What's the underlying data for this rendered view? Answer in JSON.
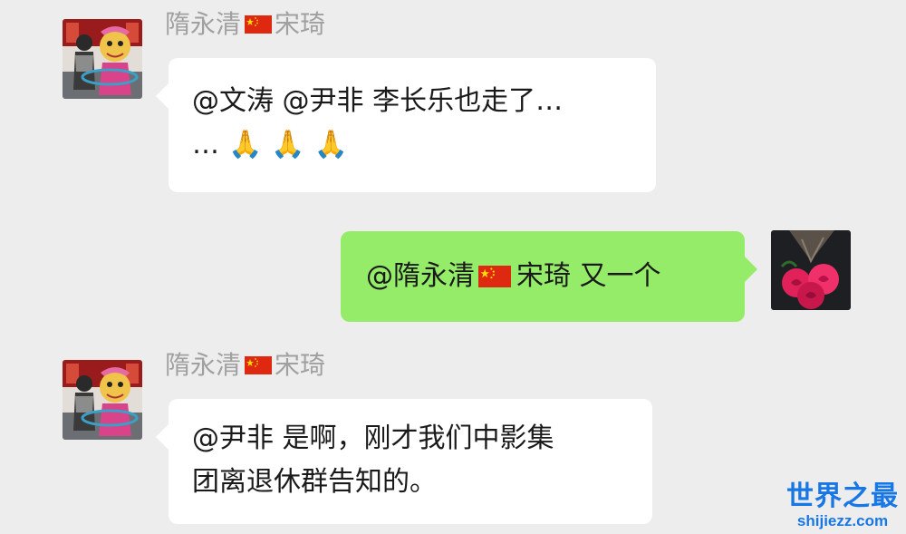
{
  "messages": [
    {
      "sender_part1": "隋永清",
      "sender_part2": "宋琦",
      "line1": "@文涛 @尹非 李长乐也走了…",
      "line2_prefix": "…",
      "emoji": "🙏"
    },
    {
      "prefix": "@隋永清",
      "suffix": "宋琦 又一个"
    },
    {
      "sender_part1": "隋永清",
      "sender_part2": "宋琦",
      "line1": "@尹非 是啊，刚才我们中影集",
      "line2": "团离退休群告知的。"
    }
  ],
  "icons": {
    "flag": "china-flag-icon",
    "emoji": "folded-hands-icon"
  },
  "watermark": {
    "title": "世界之最",
    "url": "shijiezz.com"
  },
  "colors": {
    "background": "#ededed",
    "incoming_bubble": "#ffffff",
    "outgoing_bubble": "#95ec69",
    "name_text": "#a0a0a0",
    "watermark": "#1877e6"
  }
}
